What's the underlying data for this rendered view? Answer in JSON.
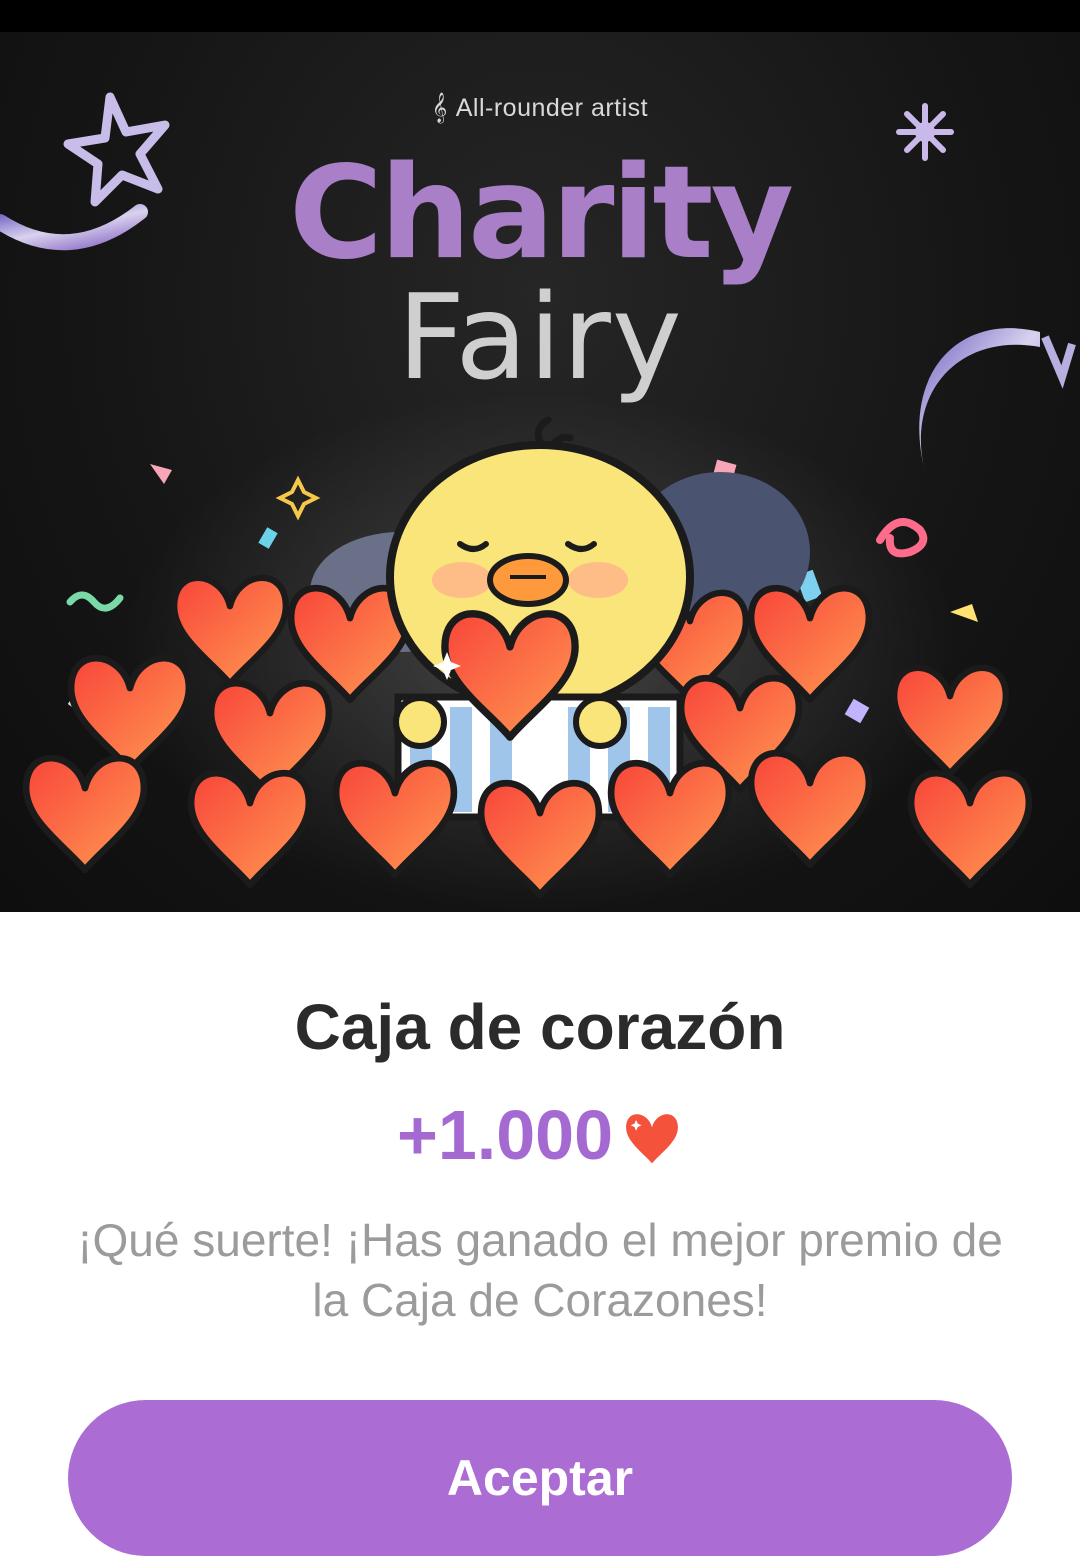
{
  "banner": {
    "subtitle": "All-rounder artist",
    "title_main": "Charity",
    "title_sub": "Fairy"
  },
  "reward": {
    "name": "Caja de corazón",
    "amount": "+1.000",
    "message": "¡Qué suerte! ¡Has ganado el mejor premio de la Caja de Corazones!"
  },
  "actions": {
    "accept_label": "Aceptar"
  },
  "colors": {
    "accent": "#ab6cd4",
    "amount_text": "#a56ad2",
    "heart": "#f5523c"
  },
  "icons": {
    "note": "treble-clef-icon",
    "heart": "heart-icon"
  }
}
